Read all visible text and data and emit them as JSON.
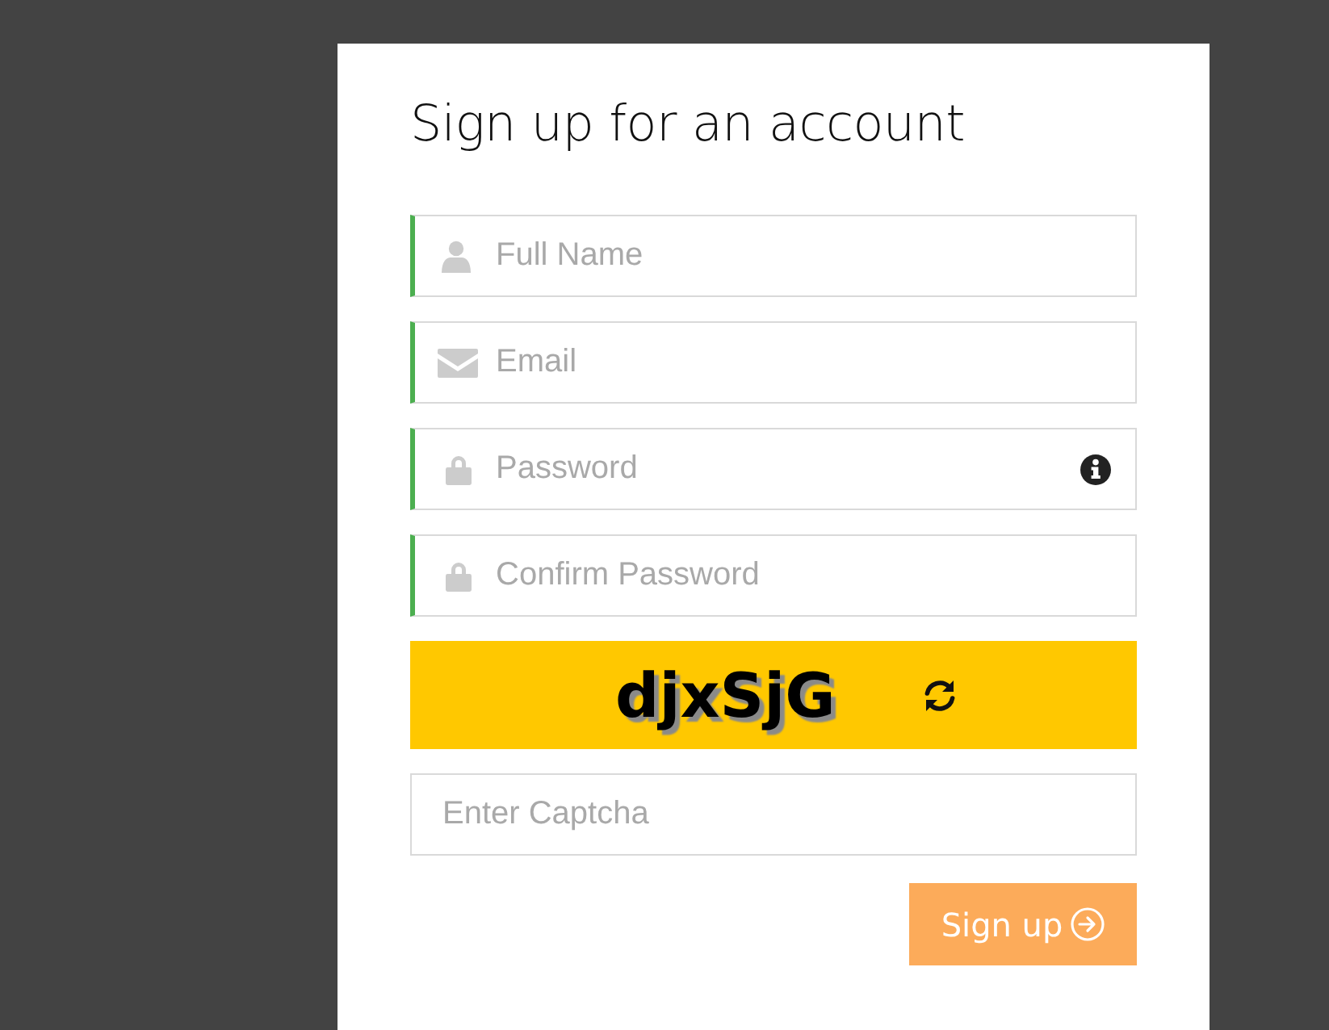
{
  "title": "Sign up for an account",
  "fields": [
    {
      "kind": "name",
      "placeholder": "Full Name",
      "valid": true,
      "has_info": false
    },
    {
      "kind": "email",
      "placeholder": "Email",
      "valid": true,
      "has_info": false
    },
    {
      "kind": "password",
      "placeholder": "Password",
      "valid": true,
      "has_info": true
    },
    {
      "kind": "password",
      "placeholder": "Confirm Password",
      "valid": true,
      "has_info": false
    }
  ],
  "captcha": {
    "code": "djxSjG"
  },
  "captcha_input": {
    "placeholder": "Enter Captcha",
    "valid": false
  },
  "submit": {
    "label": "Sign up"
  }
}
